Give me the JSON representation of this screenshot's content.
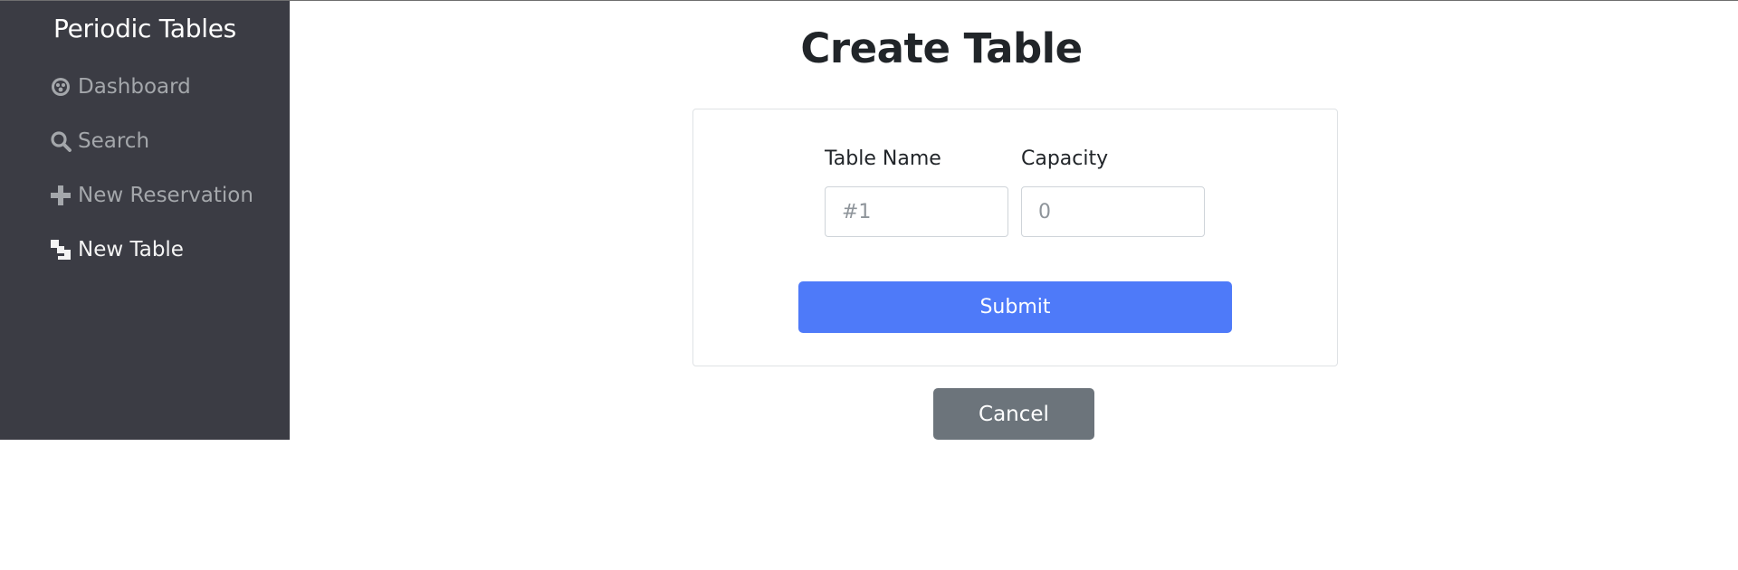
{
  "brand": {
    "title": "Periodic Tables"
  },
  "sidebar": {
    "items": [
      {
        "label": "Dashboard",
        "icon": "dashboard-icon",
        "active": false
      },
      {
        "label": "Search",
        "icon": "search-icon",
        "active": false
      },
      {
        "label": "New Reservation",
        "icon": "plus-icon",
        "active": false
      },
      {
        "label": "New Table",
        "icon": "table-icon",
        "active": true
      }
    ]
  },
  "main": {
    "title": "Create Table",
    "form": {
      "table_name": {
        "label": "Table Name",
        "placeholder": "#1",
        "value": ""
      },
      "capacity": {
        "label": "Capacity",
        "placeholder": "0",
        "value": ""
      },
      "submit_label": "Submit"
    },
    "cancel_label": "Cancel"
  },
  "colors": {
    "sidebar_bg": "#3b3c44",
    "sidebar_text": "#a4a7ab",
    "sidebar_active_text": "#f4f4f4",
    "primary": "#4e7af9",
    "secondary": "#6c747b",
    "border": "#dfe2e5"
  }
}
